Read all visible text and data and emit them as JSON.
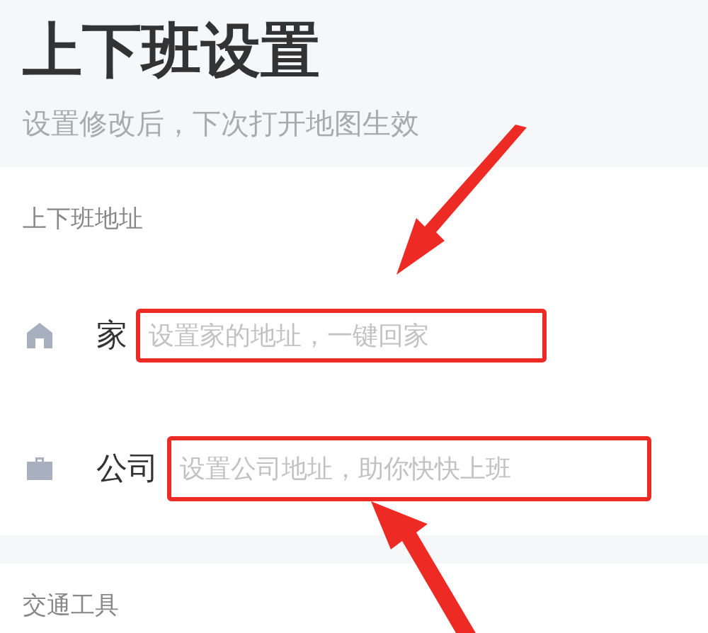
{
  "header": {
    "title": "上下班设置",
    "subtitle": "设置修改后，下次打开地图生效"
  },
  "address_section": {
    "label": "上下班地址",
    "rows": [
      {
        "kind": "home",
        "label": "家",
        "placeholder": "设置家的地址，一键回家",
        "highlighted": true
      },
      {
        "kind": "company",
        "label": "公司",
        "placeholder": "设置公司地址，助你快快上班",
        "highlighted": true
      }
    ]
  },
  "transport_section": {
    "label": "交通工具"
  }
}
